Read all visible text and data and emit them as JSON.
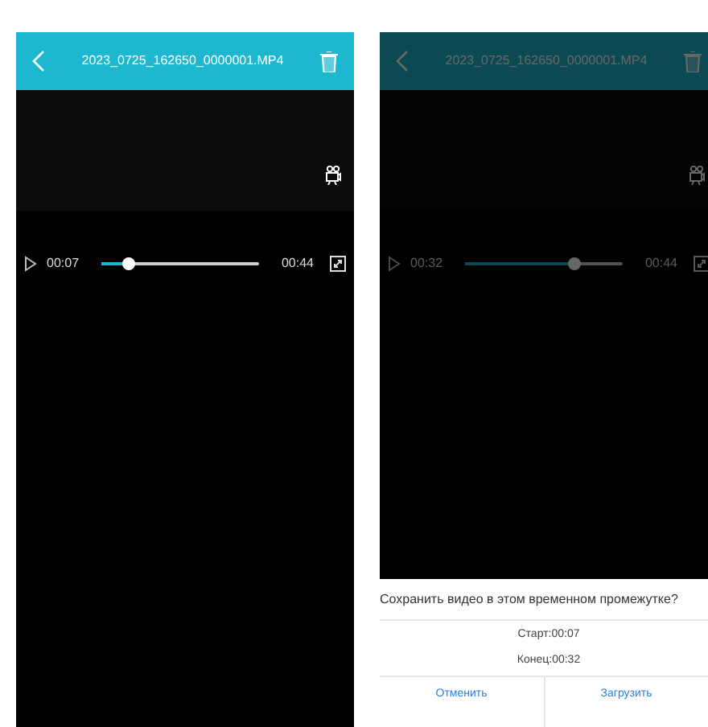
{
  "screens": [
    {
      "title": "2023_0725_162650_0000001.MP4",
      "current_time": "00:07",
      "total_time": "00:44",
      "level": 0.17,
      "dimmed": false
    },
    {
      "title": "2023_0725_162650_0000001.MP4",
      "current_time": "00:32",
      "total_time": "00:44",
      "level": 0.69,
      "dimmed": true,
      "dialog": {
        "question": "Сохранить видео в этом временном промежутке?",
        "start": "Старт:00:07",
        "end": "Конец:00:32",
        "buttons": [
          "Отменить",
          "Загрузить"
        ]
      }
    }
  ]
}
